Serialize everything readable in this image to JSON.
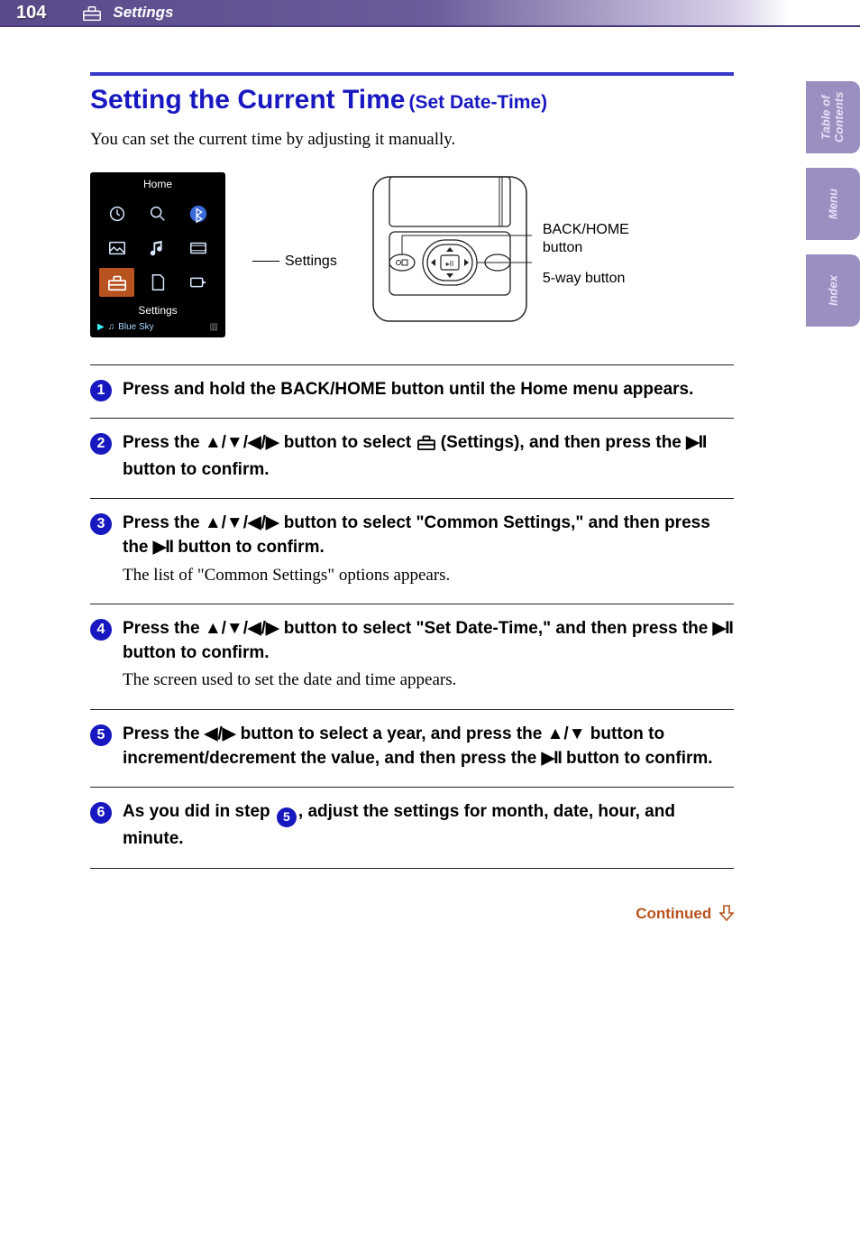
{
  "header": {
    "page_number": "104",
    "section": "Settings"
  },
  "title": {
    "main": "Setting the Current Time",
    "sub": "(Set Date-Time)"
  },
  "intro": "You can set the current time by adjusting it manually.",
  "screen_diagram": {
    "title": "Home",
    "menu_label": "Settings",
    "footer_track": "Blue Sky",
    "callout": "Settings"
  },
  "device_diagram": {
    "label_back": "BACK/HOME",
    "label_back2": "button",
    "label_5way": "5-way button"
  },
  "steps": [
    {
      "num": "1",
      "bold": "Press and hold the BACK/HOME button until the Home menu appears.",
      "sub": ""
    },
    {
      "num": "2",
      "bold_a": "Press the ",
      "bold_arrows": "▲/▼/◀/▶",
      "bold_b": " button to select ",
      "bold_c": " (Settings), and then press the ",
      "bold_play": "▶II",
      "bold_d": " button to confirm.",
      "sub": ""
    },
    {
      "num": "3",
      "bold_a": "Press the ",
      "bold_arrows": "▲/▼/◀/▶",
      "bold_b": " button to select \"Common Settings,\" and then press the ",
      "bold_play": "▶II",
      "bold_c": " button to confirm.",
      "sub": "The list of \"Common Settings\" options appears."
    },
    {
      "num": "4",
      "bold_a": "Press the ",
      "bold_arrows": "▲/▼/◀/▶",
      "bold_b": " button to select \"Set Date-Time,\" and then press the ",
      "bold_play": "▶II",
      "bold_c": " button to confirm.",
      "sub": "The screen used to set the date and time appears."
    },
    {
      "num": "5",
      "bold_a": "Press the ",
      "bold_arrows1": "◀/▶",
      "bold_b": " button to select a year, and press the ",
      "bold_arrows2": "▲/▼",
      "bold_c": " button to increment/decrement the value, and then press the ",
      "bold_play": "▶II",
      "bold_d": " button to confirm.",
      "sub": ""
    },
    {
      "num": "6",
      "bold_a": "As you did in step ",
      "ref": "5",
      "bold_b": ", adjust the settings for month, date, hour, and minute.",
      "sub": ""
    }
  ],
  "continued": "Continued",
  "side_tabs": {
    "toc1": "Table of",
    "toc2": "Contents",
    "menu": "Menu",
    "index": "Index"
  }
}
